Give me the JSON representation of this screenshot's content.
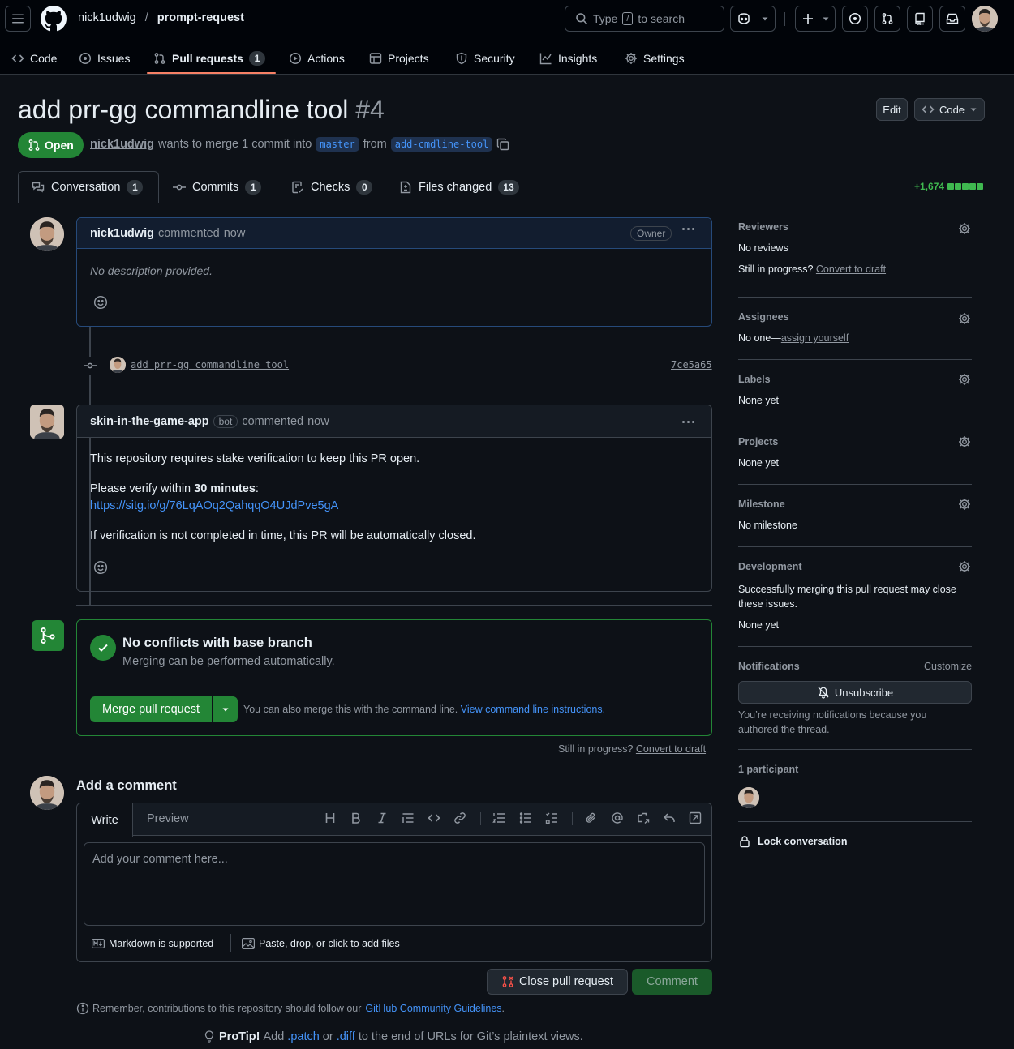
{
  "header": {
    "owner": "nick1udwig",
    "separator": "/",
    "repo": "prompt-request",
    "search_prefix": "Type",
    "search_key": "/",
    "search_suffix": "to search"
  },
  "nav": {
    "code": "Code",
    "issues": "Issues",
    "pulls": "Pull requests",
    "pulls_count": "1",
    "actions": "Actions",
    "projects": "Projects",
    "security": "Security",
    "insights": "Insights",
    "settings": "Settings"
  },
  "pr": {
    "title": "add prr-gg commandline tool",
    "number": "#4",
    "status": "Open",
    "author": "nick1udwig",
    "merge_text": "wants to merge 1 commit into",
    "base": "master",
    "from": "from",
    "head": "add-cmdline-tool",
    "edit": "Edit",
    "code": "Code"
  },
  "tabs": {
    "conversation": "Conversation",
    "conversation_count": "1",
    "commits": "Commits",
    "commits_count": "1",
    "checks": "Checks",
    "checks_count": "0",
    "files": "Files changed",
    "files_count": "13",
    "additions": "+1,674"
  },
  "comment1": {
    "author": "nick1udwig",
    "action": "commented",
    "time": "now",
    "badge": "Owner",
    "body": "No description provided."
  },
  "commit": {
    "message": "add prr-gg commandline tool",
    "sha": "7ce5a65"
  },
  "comment2": {
    "author": "skin-in-the-game-app",
    "badge": "bot",
    "action": "commented",
    "time": "now",
    "p1": "This repository requires stake verification to keep this PR open.",
    "p2a": "Please verify within ",
    "p2b": "30 minutes",
    "p2c": ":",
    "link": "https://sitg.io/g/76LqAOq2QahqqO4UJdPve5gA",
    "p3": "If verification is not completed in time, this PR will be automatically closed."
  },
  "merge": {
    "title": "No conflicts with base branch",
    "subtitle": "Merging can be performed automatically.",
    "button": "Merge pull request",
    "hint": "You can also merge this with the command line.",
    "hint_link": "View command line instructions.",
    "draft_q": "Still in progress?",
    "draft_link": "Convert to draft"
  },
  "add_comment": {
    "title": "Add a comment",
    "write": "Write",
    "preview": "Preview",
    "placeholder": "Add your comment here...",
    "markdown": "Markdown is supported",
    "files": "Paste, drop, or click to add files",
    "close": "Close pull request",
    "comment": "Comment"
  },
  "footer": {
    "remember": "Remember, contributions to this repository should follow our",
    "guidelines": "GitHub Community Guidelines",
    "period": ".",
    "protip": "ProTip!",
    "add": "Add",
    "patch": ".patch",
    "or": "or",
    "diff": ".diff",
    "rest": "to the end of URLs for Git’s plaintext views."
  },
  "sidebar": {
    "reviewers": "Reviewers",
    "no_reviews": "No reviews",
    "still": "Still in progress?",
    "convert": "Convert to draft",
    "assignees": "Assignees",
    "no_one": "No one—",
    "assign_yourself": "assign yourself",
    "labels": "Labels",
    "labels_value": "None yet",
    "projects": "Projects",
    "projects_value": "None yet",
    "milestone": "Milestone",
    "milestone_value": "No milestone",
    "development": "Development",
    "development_text": "Successfully merging this pull request may close these issues.",
    "development_value": "None yet",
    "notifications": "Notifications",
    "customize": "Customize",
    "unsubscribe": "Unsubscribe",
    "notif_text": "You’re receiving notifications because you authored the thread.",
    "participants": "1 participant",
    "lock": "Lock conversation"
  },
  "colors": {
    "bg": "#0d1117",
    "green": "#238636",
    "accent": "#4493f8",
    "border": "#3d444d",
    "muted": "#9198a1"
  }
}
